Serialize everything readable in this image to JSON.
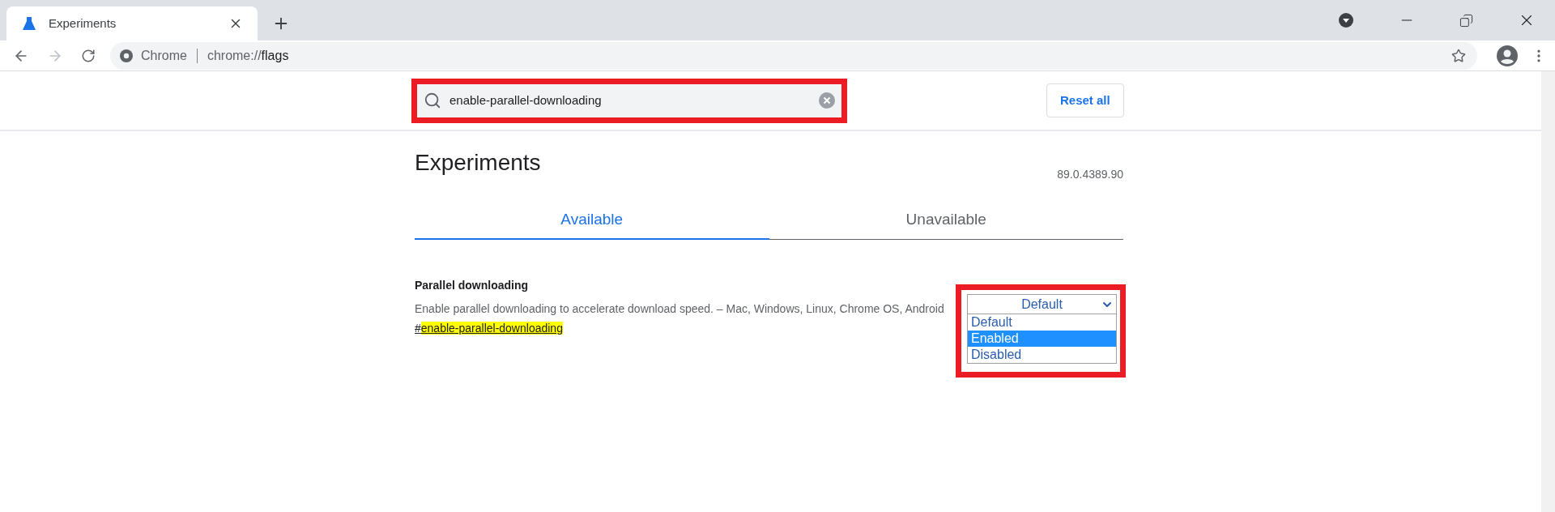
{
  "browser": {
    "tabs": [
      {
        "title": "Experiments",
        "selected": true
      }
    ],
    "address": {
      "site_label": "Chrome",
      "url_prefix": "chrome://",
      "url_main": "flags"
    }
  },
  "search": {
    "value": "enable-parallel-downloading"
  },
  "reset_button": "Reset all",
  "header": {
    "title": "Experiments",
    "version": "89.0.4389.90"
  },
  "content_tabs": [
    {
      "label": "Available",
      "selected": true
    },
    {
      "label": "Unavailable",
      "selected": false
    }
  ],
  "flags": [
    {
      "name": "Parallel downloading",
      "description": "Enable parallel downloading to accelerate download speed. – Mac, Windows, Linux, Chrome OS, Android",
      "link_prefix": "#",
      "link_match": "enable-parallel-downloading",
      "select_value": "Default",
      "options": [
        {
          "label": "Default",
          "selected": false
        },
        {
          "label": "Enabled",
          "selected": true
        },
        {
          "label": "Disabled",
          "selected": false
        }
      ]
    }
  ]
}
